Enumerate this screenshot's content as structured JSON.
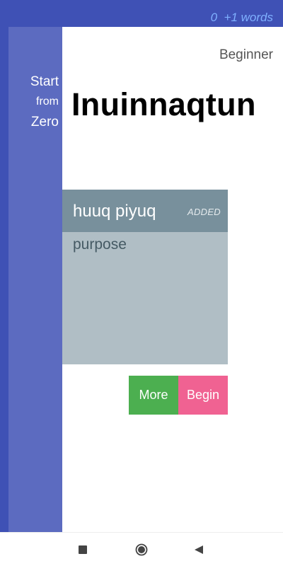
{
  "status_bar": {
    "word_counter": "0  +1 words"
  },
  "sidebar": {
    "line1": "Start",
    "line2": "from",
    "line3": "Zero"
  },
  "header": {
    "level": "Beginner",
    "language": "Inuinnaqtun"
  },
  "word_card": {
    "term": "huuq piyuq",
    "badge": "ADDED",
    "definition": "purpose"
  },
  "actions": {
    "more_label": "More",
    "begin_label": "Begin"
  },
  "nav": {
    "recents_icon": "square-icon",
    "home_icon": "circle-icon",
    "back_icon": "triangle-icon"
  },
  "colors": {
    "primary": "#3f51b5",
    "sidebar": "#5c6bc0",
    "card_header": "#78909c",
    "card_body": "#b0bec5",
    "more": "#4caf50",
    "begin": "#f06292",
    "counter": "#7fb0ff"
  }
}
